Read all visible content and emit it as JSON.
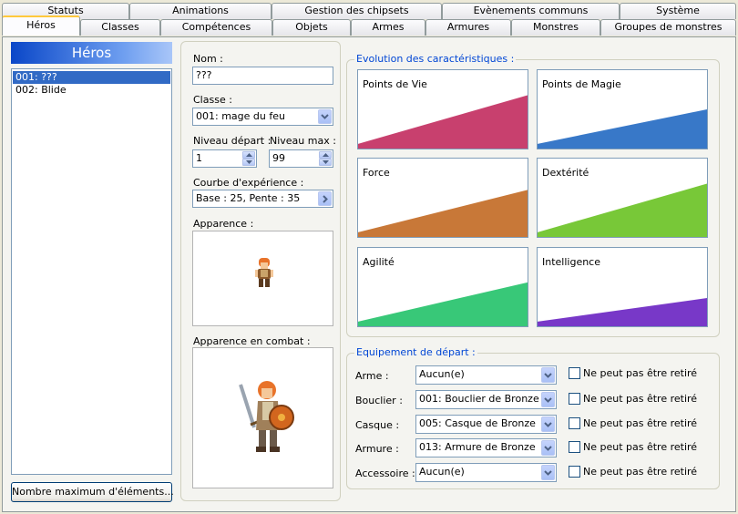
{
  "tabs_row1": [
    "Statuts",
    "Animations",
    "Gestion des chipsets",
    "Evènements communs",
    "Système"
  ],
  "tabs_row2": [
    "Héros",
    "Classes",
    "Compétences",
    "Objets",
    "Armes",
    "Armures",
    "Monstres",
    "Groupes de monstres"
  ],
  "active_tab": "Héros",
  "left_panel": {
    "header": "Héros",
    "items": [
      "001: ???",
      "002: Blide"
    ],
    "selected_index": 0,
    "max_button": "Nombre maximum d'éléments..."
  },
  "form": {
    "name_label": "Nom :",
    "name_value": "???",
    "class_label": "Classe :",
    "class_value": "001: mage du feu",
    "level_start_label": "Niveau départ :",
    "level_start_value": "1",
    "level_max_label": "Niveau max :",
    "level_max_value": "99",
    "exp_label": "Courbe d'expérience :",
    "exp_value": "Base : 25, Pente : 35",
    "appearance_label": "Apparence :",
    "battle_label": "Apparence en combat :"
  },
  "stats": {
    "legend": "Evolution des caractéristiques :",
    "items": [
      {
        "name": "Points de Vie",
        "color": "#c8406e",
        "start": 0.06,
        "end": 0.68
      },
      {
        "name": "Points de Magie",
        "color": "#3878c8",
        "start": 0.06,
        "end": 0.5
      },
      {
        "name": "Force",
        "color": "#c87838",
        "start": 0.06,
        "end": 0.6
      },
      {
        "name": "Dextérité",
        "color": "#78c838",
        "start": 0.06,
        "end": 0.68
      },
      {
        "name": "Agilité",
        "color": "#38c878",
        "start": 0.06,
        "end": 0.56
      },
      {
        "name": "Intelligence",
        "color": "#7838c8",
        "start": 0.06,
        "end": 0.36
      }
    ]
  },
  "equipment": {
    "legend": "Equipement de départ :",
    "checkbox_label": "Ne peut pas être retiré",
    "rows": [
      {
        "label": "Arme :",
        "value": "Aucun(e)"
      },
      {
        "label": "Bouclier :",
        "value": "001: Bouclier de Bronze"
      },
      {
        "label": "Casque :",
        "value": "005: Casque de Bronze"
      },
      {
        "label": "Armure :",
        "value": "013: Armure de Bronze"
      },
      {
        "label": "Accessoire :",
        "value": "Aucun(e)"
      }
    ]
  }
}
